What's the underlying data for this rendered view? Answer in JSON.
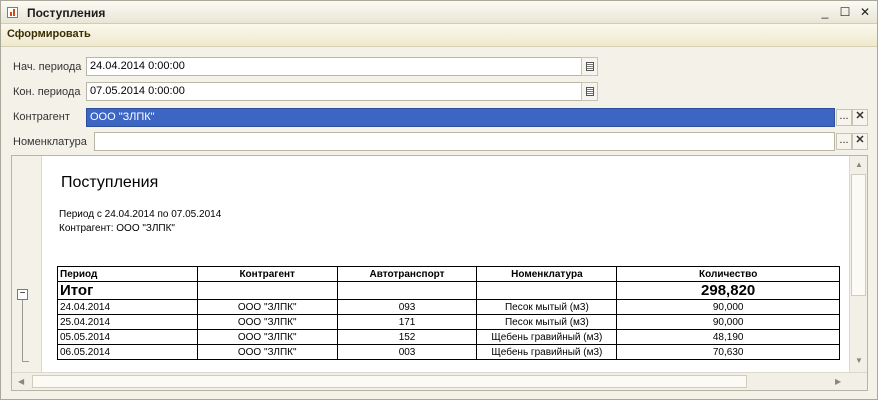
{
  "window": {
    "title": "Поступления",
    "minimize": "_",
    "maximize": "☐",
    "close": "✕"
  },
  "toolbar": {
    "generate_label": "Сформировать"
  },
  "filters": {
    "start_label": "Нач. периода",
    "start_value": "24.04.2014  0:00:00",
    "end_label": "Кон. периода",
    "end_value": "07.05.2014  0:00:00",
    "counterparty_label": "Контрагент",
    "counterparty_value": "ООО \"ЗЛПК\"",
    "nomenclature_label": "Номенклатура",
    "nomenclature_value": "",
    "select_glyph": "...",
    "clear_glyph": "✕"
  },
  "report": {
    "title": "Поступления",
    "period_line": "Период с 24.04.2014 по 07.05.2014",
    "counterparty_line": "Контрагент: ООО \"ЗЛПК\"",
    "columns": [
      "Период",
      "Контрагент",
      "Автотранспорт",
      "Номенклатура",
      "Количество"
    ],
    "total_label": "Итог",
    "total_value": "298,820",
    "rows": [
      [
        "24.04.2014",
        "ООО \"ЗЛПК\"",
        "093",
        "Песок мытый (м3)",
        "90,000"
      ],
      [
        "25.04.2014",
        "ООО \"ЗЛПК\"",
        "171",
        "Песок мытый (м3)",
        "90,000"
      ],
      [
        "05.05.2014",
        "ООО \"ЗЛПК\"",
        "152",
        "Щебень гравийный (м3)",
        "48,190"
      ],
      [
        "06.05.2014",
        "ООО \"ЗЛПК\"",
        "003",
        "Щебень гравийный (м3)",
        "70,630"
      ]
    ]
  },
  "icons": {
    "app": "report-chart-icon",
    "calendar": "calendar-icon",
    "collapse": "minus-icon",
    "scroll": "arrow-icon"
  },
  "colors": {
    "selection": "#3d66c4",
    "window_bg": "#f4f2e8",
    "toolbar_bg": "#efe9cf"
  }
}
